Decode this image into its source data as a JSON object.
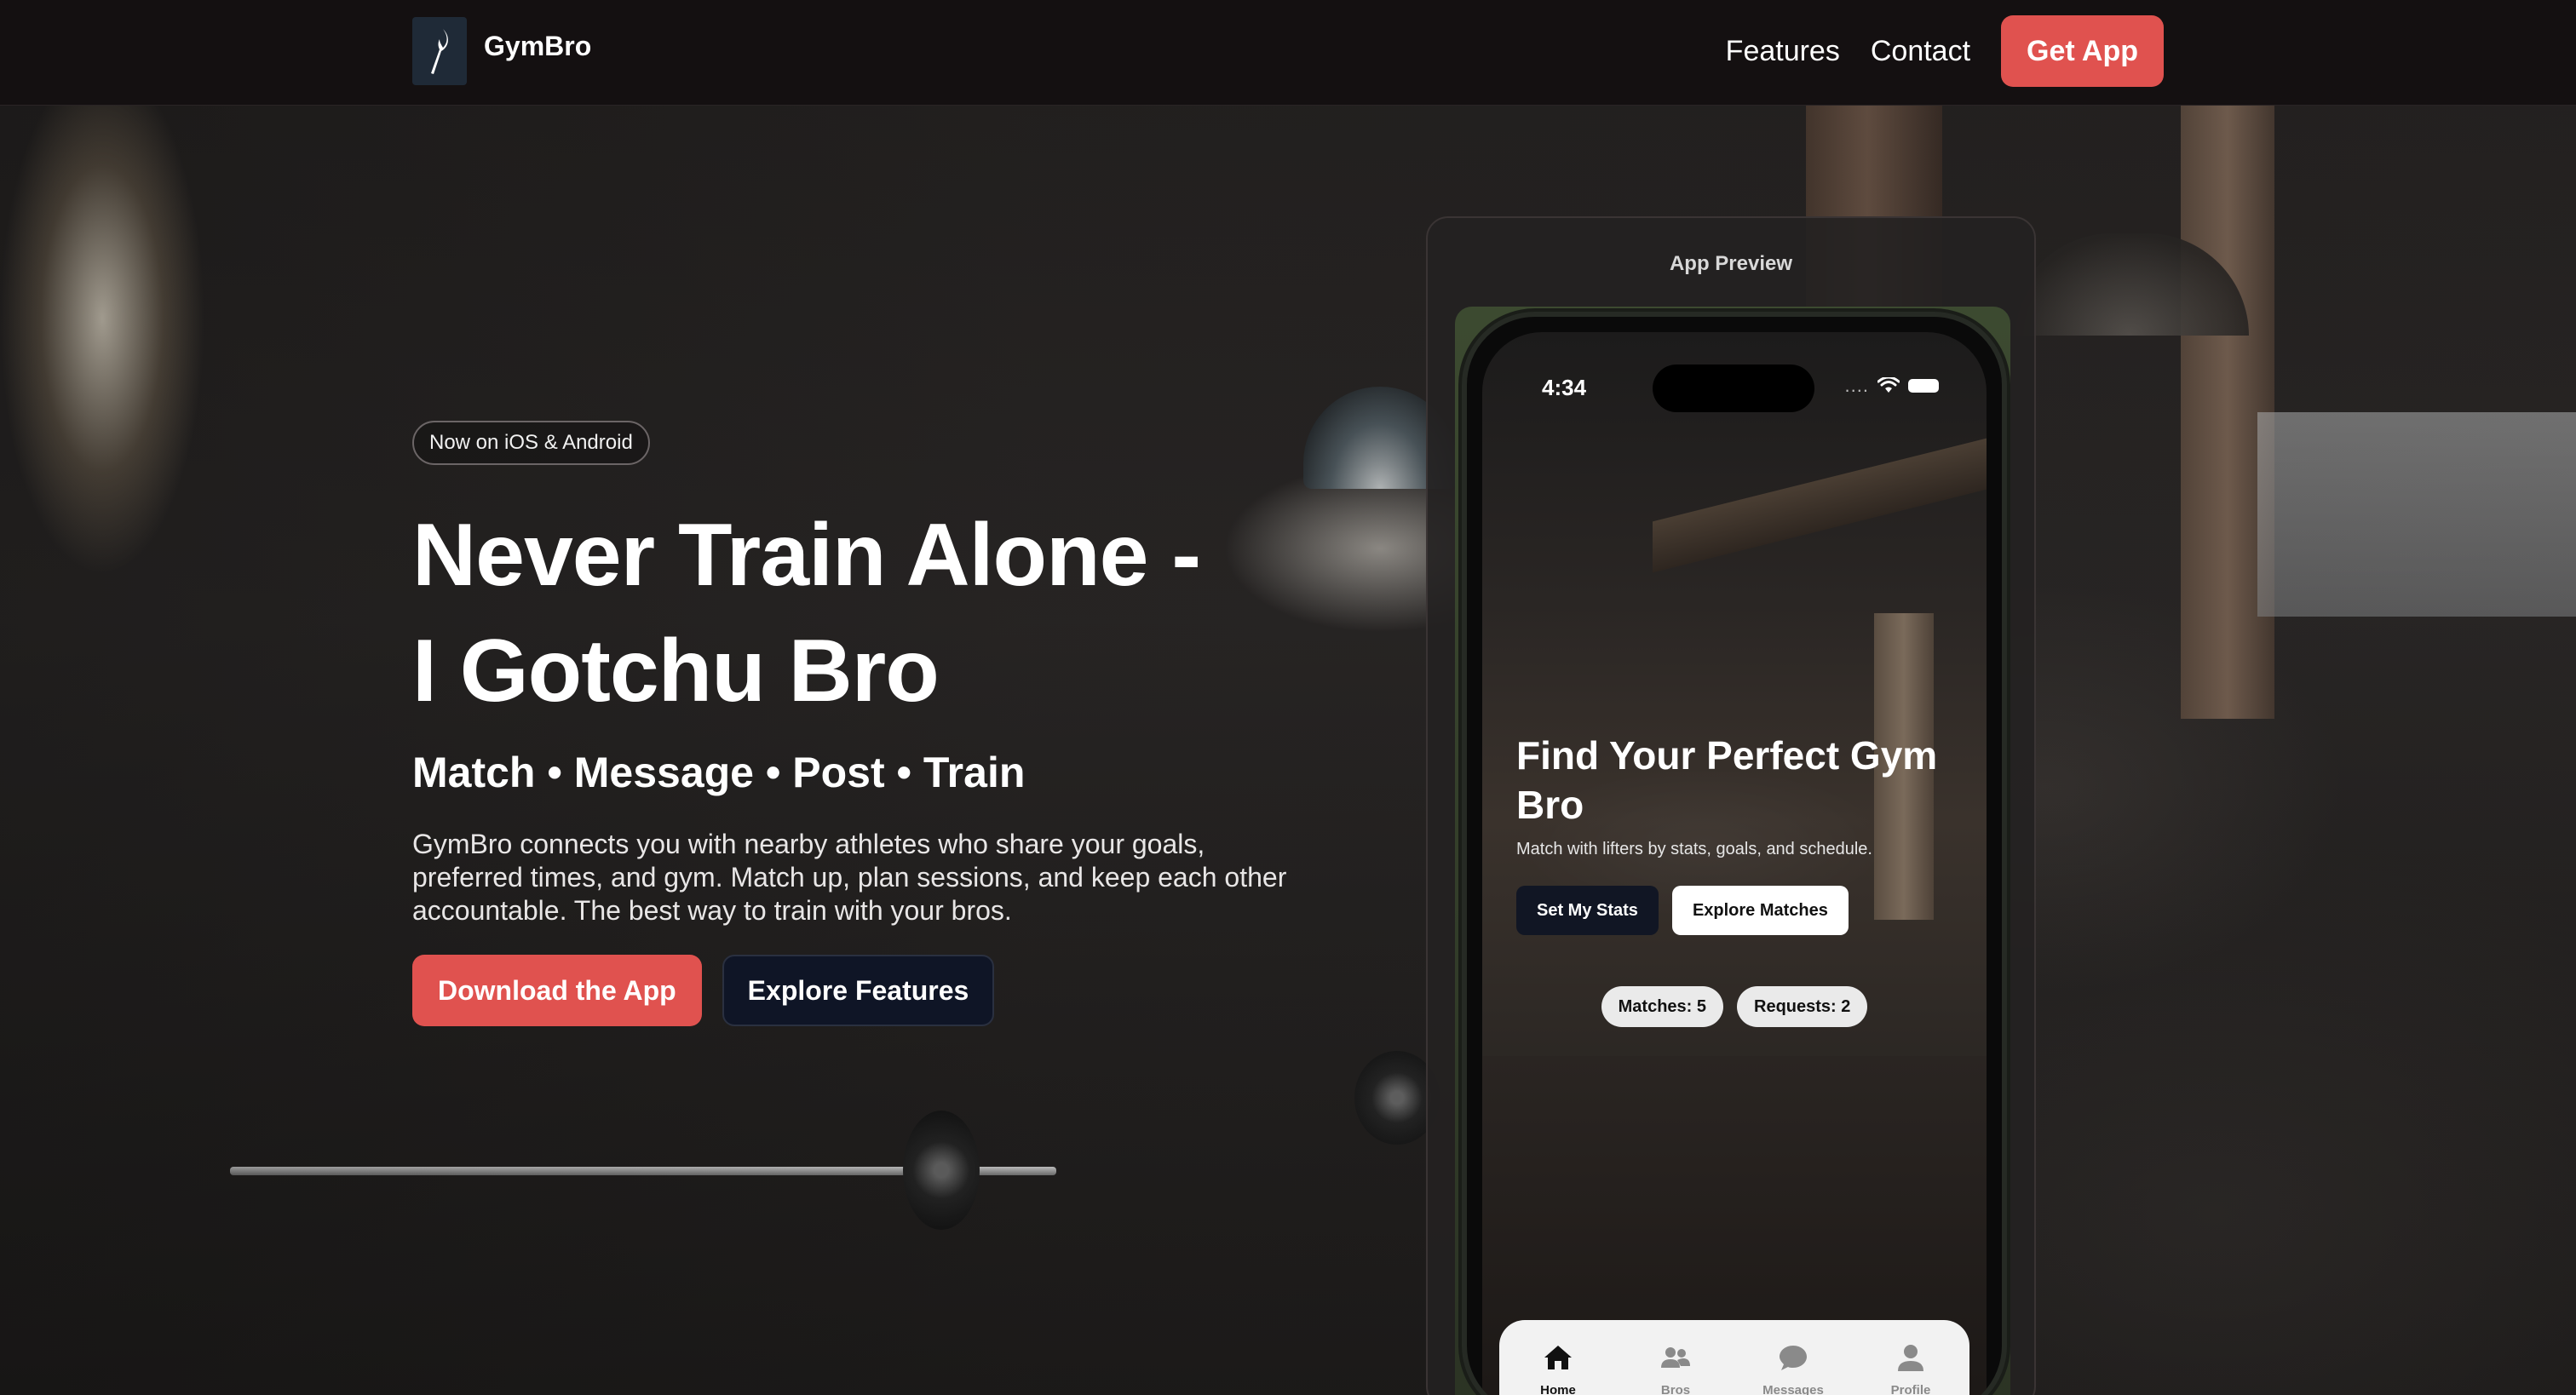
{
  "nav": {
    "brand": "GymBro",
    "links": [
      "Features",
      "Contact"
    ],
    "cta": "Get App"
  },
  "hero": {
    "badge": "Now on iOS & Android",
    "headline_line1": "Never Train Alone -",
    "headline_line2": "I Gotchu Bro",
    "subhead": "Match • Message • Post • Train",
    "description": "GymBro connects you with nearby athletes who share your goals, preferred times, and gym. Match up, plan sessions, and keep each other accountable. The best way to train with your bros.",
    "primary_cta": "Download the App",
    "secondary_cta": "Explore Features"
  },
  "preview": {
    "title": "App Preview",
    "phone": {
      "time": "4:34",
      "status_dots": "....",
      "screen_title": "Find Your Perfect Gym Bro",
      "screen_subtitle": "Match with lifters by stats, goals, and schedule.",
      "btn_stats": "Set My Stats",
      "btn_matches": "Explore Matches",
      "chip_matches": "Matches: 5",
      "chip_requests": "Requests: 2",
      "tabs": [
        {
          "label": "Home",
          "icon": "home-icon",
          "active": true
        },
        {
          "label": "Bros",
          "icon": "people-icon",
          "active": false
        },
        {
          "label": "Messages",
          "icon": "chat-bubble-icon",
          "active": false
        },
        {
          "label": "Profile",
          "icon": "person-icon",
          "active": false
        }
      ]
    }
  },
  "colors": {
    "accent": "#e0524f",
    "nav_bg": "#141011",
    "dark_button": "#0f1526"
  }
}
